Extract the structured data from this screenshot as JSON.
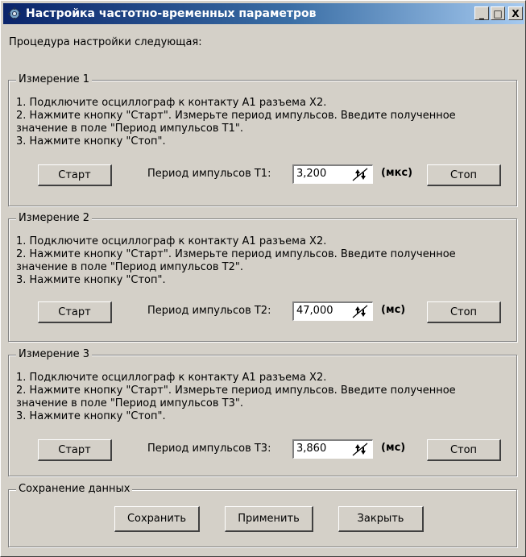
{
  "window": {
    "title": "Настройка частотно-временных параметров",
    "controls": [
      "_",
      "□",
      "X"
    ]
  },
  "intro": "Процедура настройки следующая:",
  "measurements": [
    {
      "title": "Измерение 1",
      "steps": [
        "1. Подключите осциллограф к контакту А1 разъема Х2.",
        "2. Нажмите кнопку \"Старт\". Измерьте период импульсов.  Введите полученное",
        "значение в поле \"Период импульсов Т1\".",
        "3. Нажмите кнопку \"Стоп\"."
      ],
      "start_label": "Старт",
      "period_label": "Период импульсов Т1:",
      "value": "3,200",
      "unit": "(мкс)",
      "stop_label": "Стоп"
    },
    {
      "title": "Измерение 2",
      "steps": [
        "1. Подключите осциллограф к контакту А1 разъема Х2.",
        "2. Нажмите кнопку \"Старт\". Измерьте период импульсов.  Введите полученное",
        "значение в поле \"Период импульсов Т2\".",
        "3. Нажмите кнопку \"Стоп\"."
      ],
      "start_label": "Старт",
      "period_label": "Период импульсов Т2:",
      "value": "47,000",
      "unit": "(мс)",
      "stop_label": "Стоп"
    },
    {
      "title": "Измерение 3",
      "steps": [
        "1. Подключите осциллограф к контакту А1 разъема Х2.",
        "2. Нажмите кнопку \"Старт\". Измерьте период импульсов.  Введите полученное",
        "значение в поле \"Период импульсов Т3\".",
        "3. Нажмите кнопку \"Стоп\"."
      ],
      "start_label": "Старт",
      "period_label": "Период импульсов Т3:",
      "value": "3,860",
      "unit": "(мс)",
      "stop_label": "Стоп"
    }
  ],
  "save_section": {
    "title": "Сохранение данных",
    "save_label": "Сохранить",
    "apply_label": "Применить",
    "close_label": "Закрыть"
  },
  "icons": {
    "app": "app-settings-icon",
    "spin": "spin-arrows-icon"
  },
  "colors": {
    "titlebar_start": "#0a246a",
    "titlebar_end": "#a6caf0",
    "face": "#d4d0c8"
  }
}
